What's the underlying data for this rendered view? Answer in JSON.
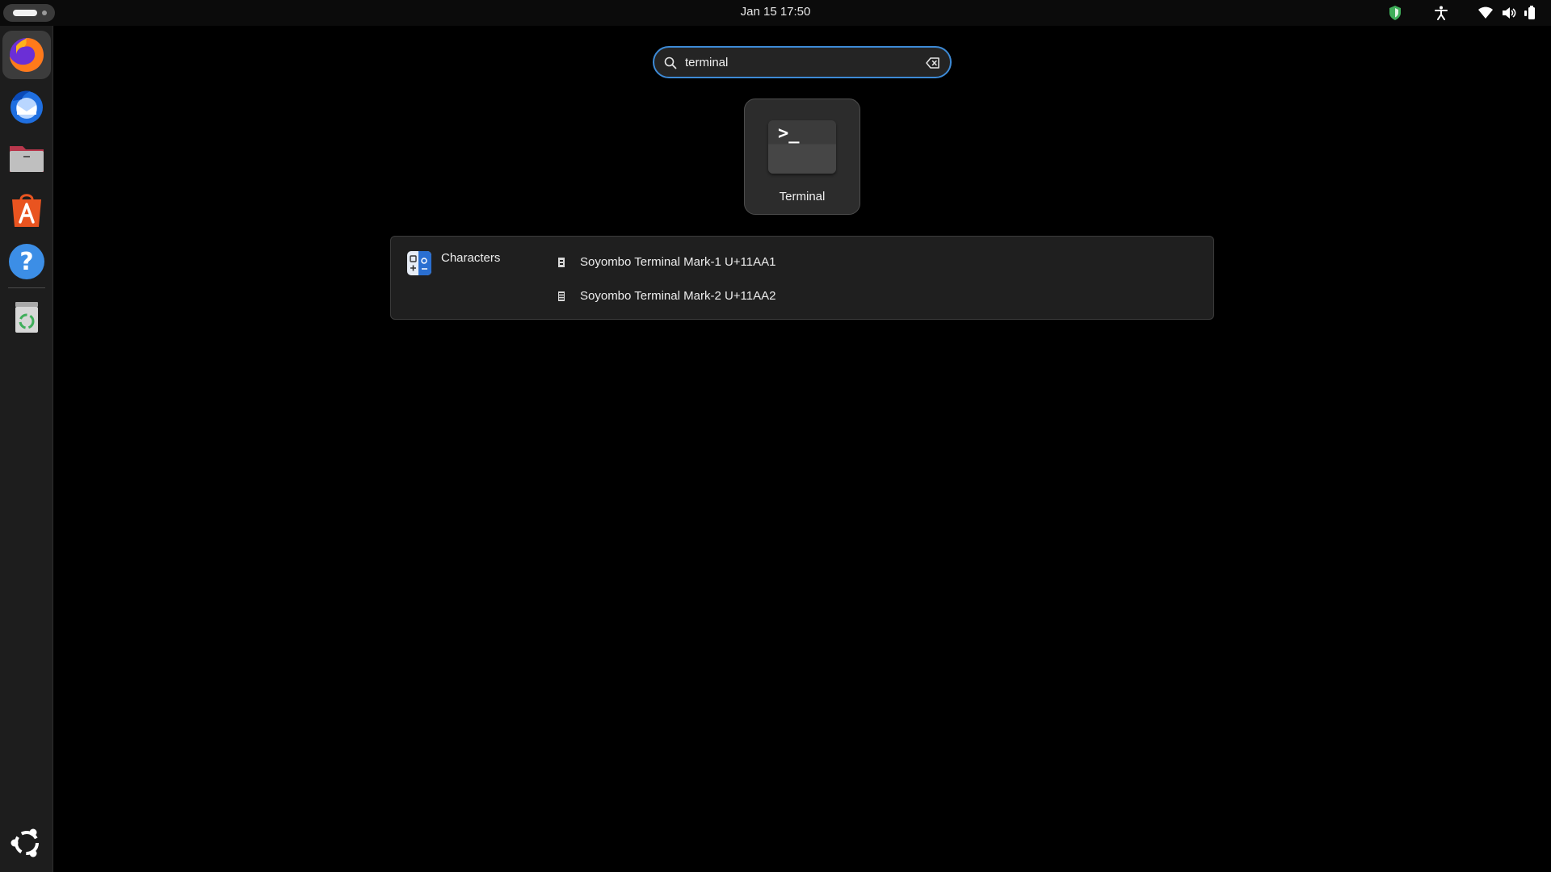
{
  "topbar": {
    "clock": "Jan 15  17:50",
    "tray_icons": [
      "shield-icon",
      "accessibility-icon",
      "wifi-icon",
      "volume-icon",
      "battery-icon"
    ]
  },
  "dock": {
    "items": [
      {
        "name": "firefox",
        "icon": "firefox-icon",
        "active": true
      },
      {
        "name": "thunderbird",
        "icon": "thunderbird-icon"
      },
      {
        "name": "files",
        "icon": "files-icon"
      },
      {
        "name": "app-center",
        "icon": "app-center-icon"
      },
      {
        "name": "help",
        "icon": "help-icon"
      },
      {
        "name": "trash",
        "icon": "trash-icon"
      }
    ],
    "apps_grid_icon": "ubuntu-logo-icon"
  },
  "search": {
    "value": "terminal",
    "icon": "search-icon",
    "clear_icon": "backspace-clear-icon"
  },
  "app_results": [
    {
      "label": "Terminal",
      "icon": "terminal-icon",
      "glyph": ">_"
    }
  ],
  "provider": {
    "name": "Characters",
    "icon": "characters-app-icon",
    "results": [
      {
        "label": "Soyombo Terminal Mark-1  U+11AA1"
      },
      {
        "label": "Soyombo Terminal Mark-2  U+11AA2"
      }
    ]
  },
  "colors": {
    "accent": "#3d8ad6",
    "panel": "#1f1f1f",
    "firefox_orange": "#ff7a1a",
    "ubuntu_orange": "#e95420"
  }
}
